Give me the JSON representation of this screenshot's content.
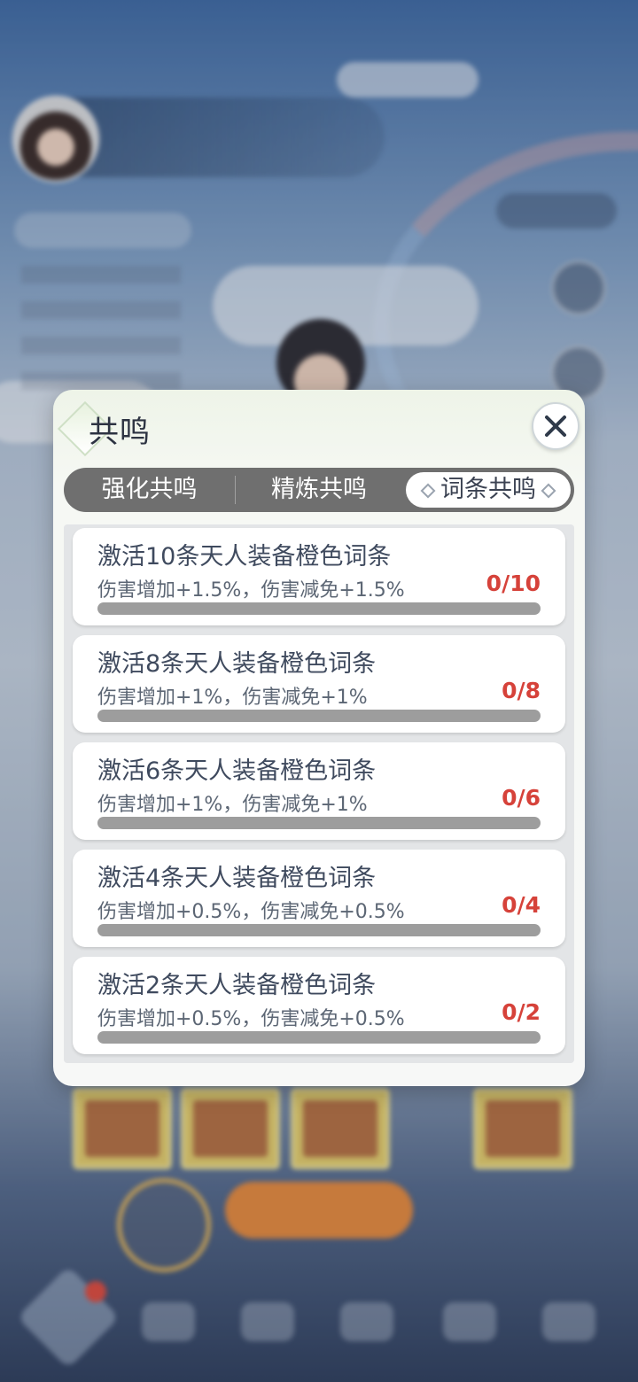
{
  "dialog": {
    "title": "共鸣",
    "close_icon": "close-icon",
    "tabs": [
      {
        "label": "强化共鸣",
        "active": false
      },
      {
        "label": "精炼共鸣",
        "active": false
      },
      {
        "label": "词条共鸣",
        "active": true
      }
    ],
    "items": [
      {
        "title": "激活10条天人装备橙色词条",
        "desc": "伤害增加+1.5%，伤害减免+1.5%",
        "count": "0/10",
        "progress": 0
      },
      {
        "title": "激活8条天人装备橙色词条",
        "desc": "伤害增加+1%，伤害减免+1%",
        "count": "0/8",
        "progress": 0
      },
      {
        "title": "激活6条天人装备橙色词条",
        "desc": "伤害增加+1%，伤害减免+1%",
        "count": "0/6",
        "progress": 0
      },
      {
        "title": "激活4条天人装备橙色词条",
        "desc": "伤害增加+0.5%，伤害减免+0.5%",
        "count": "0/4",
        "progress": 0
      },
      {
        "title": "激活2条天人装备橙色词条",
        "desc": "伤害增加+0.5%，伤害减免+0.5%",
        "count": "0/2",
        "progress": 0
      }
    ]
  },
  "colors": {
    "count_red": "#d6423a",
    "tab_bar_gray": "#6f6f6f",
    "progress_track": "#9d9d9d"
  }
}
